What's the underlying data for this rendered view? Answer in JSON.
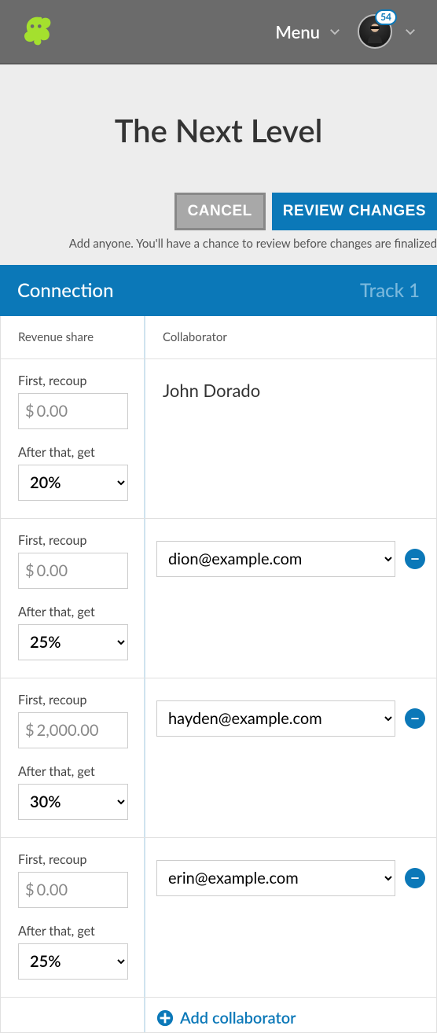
{
  "header": {
    "menu_label": "Menu",
    "badge_count": "54"
  },
  "page": {
    "title": "The Next Level",
    "cancel_label": "CANCEL",
    "review_label": "REVIEW CHANGES",
    "help_text": "Add anyone. You'll have a chance to review before changes are finalized"
  },
  "section": {
    "title": "Connection",
    "track_label": "Track 1",
    "col_revenue": "Revenue share",
    "col_collaborator": "Collaborator",
    "recoup_label": "First, recoup",
    "after_label": "After that, get",
    "add_label": "Add collaborator"
  },
  "rows": [
    {
      "recoup": "0.00",
      "percent": "20%",
      "collaborator_name": "John Dorado",
      "removable": false
    },
    {
      "recoup": "0.00",
      "percent": "25%",
      "collaborator_email": "dion@example.com",
      "removable": true
    },
    {
      "recoup": "2,000.00",
      "percent": "30%",
      "collaborator_email": "hayden@example.com",
      "removable": true
    },
    {
      "recoup": "0.00",
      "percent": "25%",
      "collaborator_email": "erin@example.com",
      "removable": true
    }
  ]
}
